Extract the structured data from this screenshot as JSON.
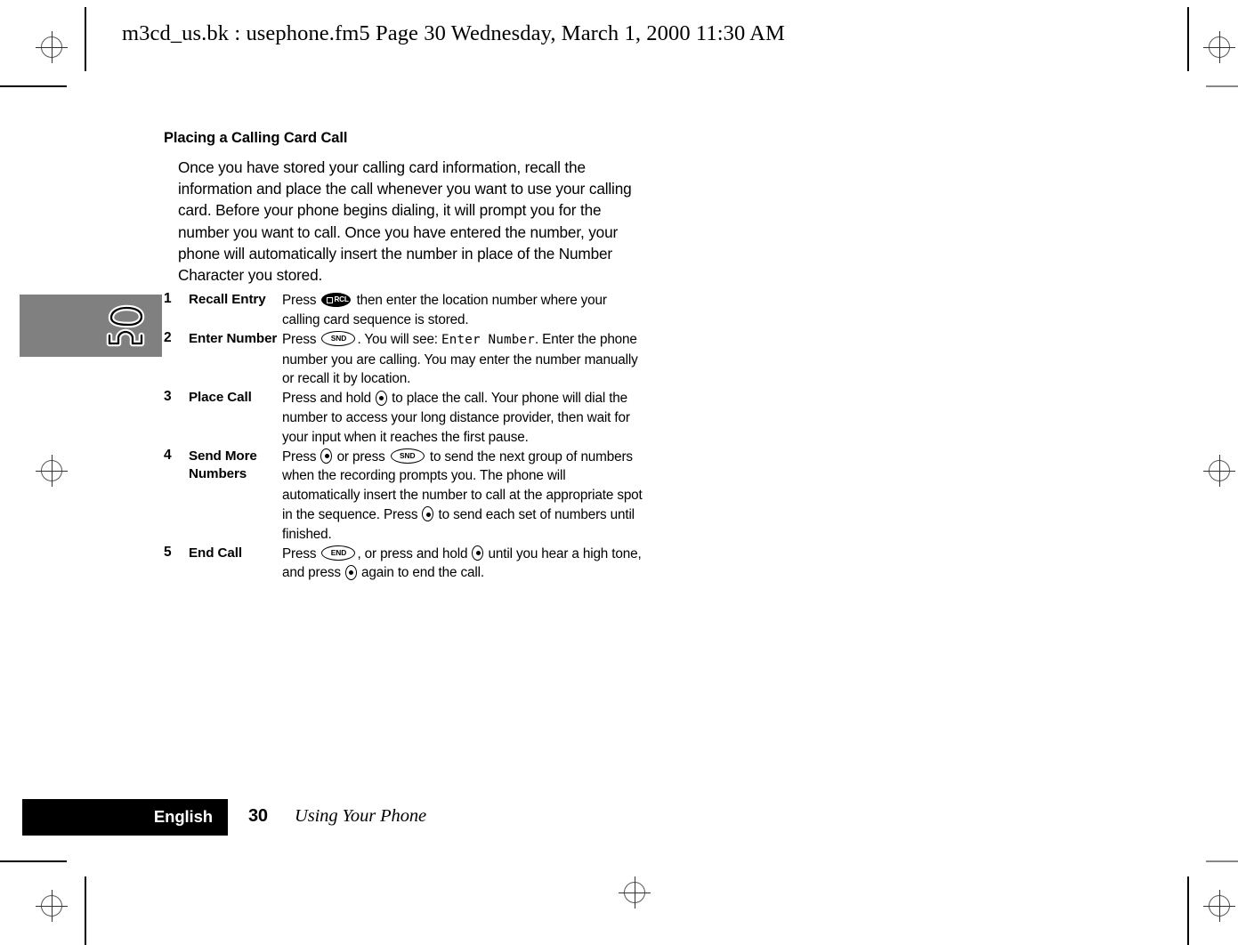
{
  "document_header": "m3cd_us.bk : usephone.fm5  Page 30  Wednesday, March 1, 2000  11:30 AM",
  "side_tab": {
    "icon": "phone-off-hook-icon",
    "background_color": "#808080"
  },
  "section": {
    "title": "Placing a Calling Card Call",
    "intro": "Once you have stored your calling card information, recall the information and place the call whenever you want to use your calling card. Before your phone begins dialing, it will prompt you for the number you want to call. Once you have entered the number, your phone will automatically insert the number in place of the Number Character you stored."
  },
  "steps": [
    {
      "number": "1",
      "label": "Recall Entry",
      "text_parts": {
        "before": "Press",
        "key": "RCL",
        "after": "then enter the location number where your calling card sequence is stored."
      }
    },
    {
      "number": "2",
      "label": "Enter Number",
      "text_parts": {
        "before": "Press",
        "key": "SND",
        "mid": ". You will see:",
        "lcd": "Enter Number",
        "after": ". Enter the phone number you are calling. You may enter the number manually or recall it by location."
      }
    },
    {
      "number": "3",
      "label": "Place Call",
      "text_parts": {
        "before": "Press and hold",
        "key": "PWR",
        "after": "to place the call. Your phone will dial the number to access your long distance provider, then wait for your input when it reaches the first pause."
      }
    },
    {
      "number": "4",
      "label": "Send More Numbers",
      "text_parts": {
        "before": "Press",
        "key": "PWR",
        "mid": "or press",
        "key2": "SND",
        "after": "to send the next group of numbers when the recording prompts you. The phone will automatically insert the number to call at the appropriate spot in the sequence. Press",
        "key3": "PWR",
        "tail": "to send each set of numbers until finished."
      }
    },
    {
      "number": "5",
      "label": "End Call",
      "text_parts": {
        "before": "Press",
        "key": "END",
        "mid": ", or press and hold",
        "key2": "PWR",
        "after": "until you hear a high tone, and press",
        "key3": "PWR",
        "tail": "again to end the call."
      }
    }
  ],
  "footer": {
    "language": "English",
    "page_number": "30",
    "section_name": "Using Your Phone",
    "bar_color": "#000000"
  }
}
